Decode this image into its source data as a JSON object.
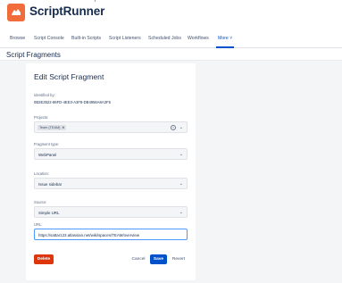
{
  "app": {
    "title": "ScriptRunner"
  },
  "nav": {
    "tabs": [
      {
        "label": "Browse"
      },
      {
        "label": "Script Console"
      },
      {
        "label": "Built-in Scripts"
      },
      {
        "label": "Script Listeners"
      },
      {
        "label": "Scheduled Jobs"
      },
      {
        "label": "Workflows"
      },
      {
        "label": "More ˅"
      }
    ]
  },
  "page": {
    "title": "Script Fragments"
  },
  "form": {
    "title": "Edit Script Fragment",
    "identified_label": "Identified by:",
    "identified_value": "0B2E3522-86FD-4EE3-A3F8-DB4956A8A3F5",
    "projects_label": "Projects:",
    "projects_tag": "Team (TEAM)",
    "fragment_type_label": "Fragment type:",
    "fragment_type_value": "WebPanel",
    "location_label": "Location:",
    "location_value": "Issue sidebar",
    "source_label": "Source:",
    "source_value": "Simple URL",
    "url_label": "URL:",
    "url_value": "https://sattar123.atlassian.net/wiki/spaces/TEAM/overview"
  },
  "buttons": {
    "delete": "Delete",
    "cancel": "Cancel",
    "save": "Save",
    "revert": "Revert"
  },
  "colors": {
    "brand": "#f26b3a",
    "primary": "#0052cc",
    "danger": "#de350b"
  }
}
